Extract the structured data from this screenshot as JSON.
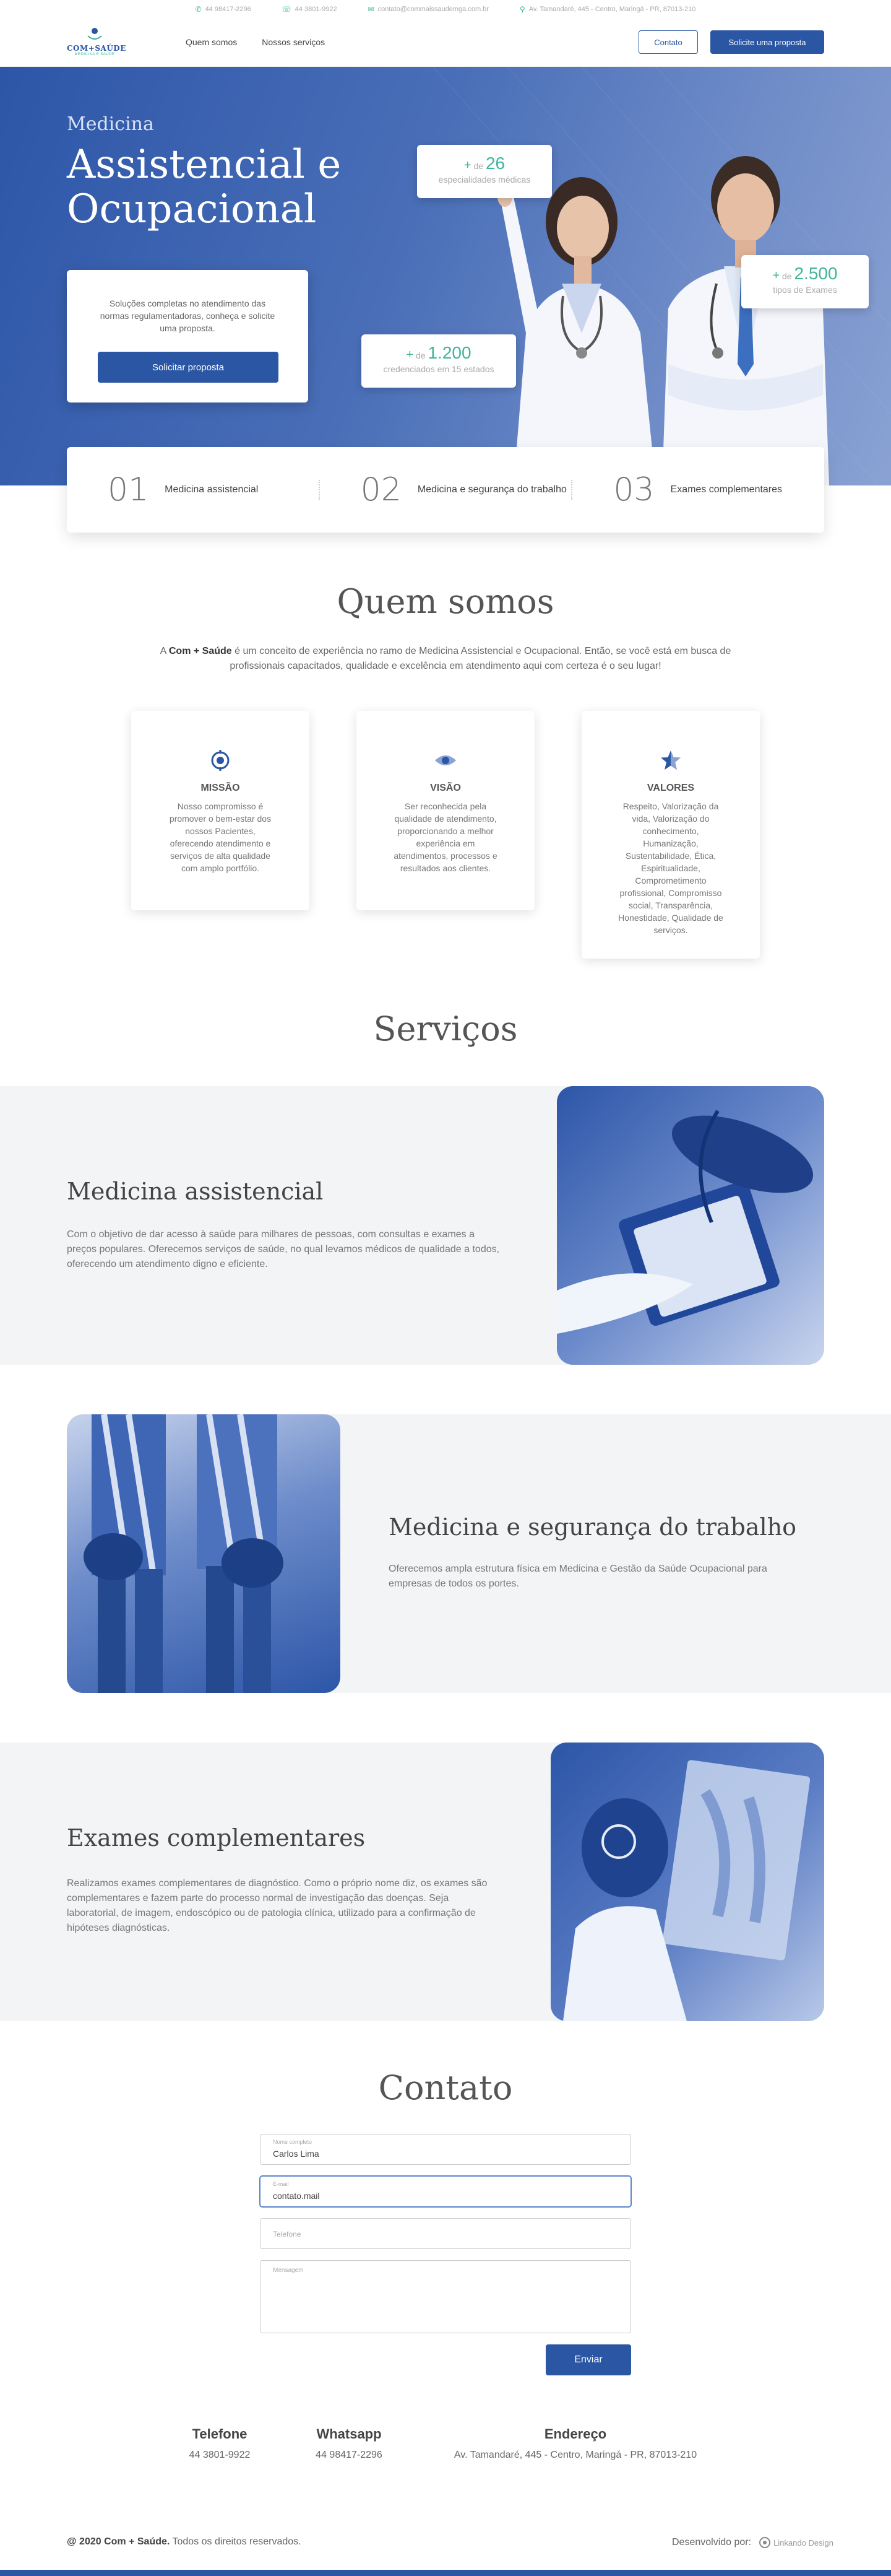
{
  "topbar": {
    "whatsapp": "44 98417-2296",
    "phone": "44 3801-9922",
    "email": "contato@commaissaudemga.com.br",
    "address": "Av. Tamandaré, 445 - Centro, Maringá - PR, 87013-210"
  },
  "header": {
    "logo_name": "COM+SAÚDE",
    "logo_tag": "MEDICINA E SAÚDE",
    "nav": [
      "Quem somos",
      "Nossos serviços"
    ],
    "contact_button": "Contato",
    "proposal_button": "Solicite uma proposta"
  },
  "hero": {
    "kicker": "Medicina",
    "title": "Assistencial e Ocupacional",
    "card_text": "Soluções completas no atendimento das normas regulamentadoras, conheça e solicite uma proposta.",
    "card_button": "Solicitar proposta",
    "stats": [
      {
        "prefix": "de",
        "number": "26",
        "label": "especialidades médicas"
      },
      {
        "prefix": "de",
        "number": "1.200",
        "label": "credenciados em 15 estados"
      },
      {
        "prefix": "de",
        "number": "2.500",
        "label": "tipos de Exames"
      }
    ]
  },
  "strip": [
    {
      "num": "01",
      "label": "Medicina assistencial"
    },
    {
      "num": "02",
      "label": "Medicina e segurança do trabalho"
    },
    {
      "num": "03",
      "label": "Exames complementares"
    }
  ],
  "about": {
    "title": "Quem somos",
    "intro_pre": "A ",
    "intro_brand": "Com + Saúde",
    "intro_post": " é um conceito de experiência no ramo de Medicina Assistencial e Ocupacional. Então, se você está em busca de profissionais capacitados, qualidade e excelência em atendimento aqui com certeza é o seu lugar!",
    "cards": [
      {
        "icon": "target-icon",
        "title": "MISSÃO",
        "text": "Nosso compromisso é promover o bem-estar dos nossos Pacientes, oferecendo atendimento e serviços de alta qualidade com amplo portfólio."
      },
      {
        "icon": "eye-icon",
        "title": "VISÃO",
        "text": "Ser reconhecida pela qualidade de atendimento, proporcionando a melhor experiência em atendimentos, processos e resultados aos clientes."
      },
      {
        "icon": "star-icon",
        "title": "VALORES",
        "text": "Respeito, Valorização da vida, Valorização do conhecimento, Humanização, Sustentabilidade, Ética, Espiritualidade, Comprometimento profissional, Compromisso social, Transparência, Honestidade, Qualidade de serviços."
      }
    ]
  },
  "services": {
    "title": "Serviços",
    "items": [
      {
        "title": "Medicina assistencial",
        "text": "Com o objetivo de dar acesso à saúde para milhares de pessoas, com consultas e exames a preços populares. Oferecemos serviços de saúde, no qual levamos médicos de qualidade a todos, oferecendo um atendimento digno e eficiente."
      },
      {
        "title": "Medicina e segurança do trabalho",
        "text": "Oferecemos ampla estrutura física em Medicina e Gestão da Saúde Ocupacional para empresas de todos os portes."
      },
      {
        "title": "Exames complementares",
        "text": "Realizamos exames complementares de diagnóstico. Como o próprio nome diz, os exames são complementares e fazem parte do processo normal de investigação das doenças. Seja laboratorial, de imagem, endoscópico ou de patologia clínica, utilizado para a confirmação de hipóteses diagnósticas."
      }
    ]
  },
  "contact": {
    "title": "Contato",
    "fields": [
      {
        "label": "Nome completo",
        "value": "Carlos Lima"
      },
      {
        "label": "E-mail",
        "value": "contato.mail"
      },
      {
        "placeholder": "Telefone"
      },
      {
        "placeholder": "Mensagem"
      }
    ],
    "send": "Enviar",
    "info": [
      {
        "key": "Telefone",
        "value": "44 3801-9922"
      },
      {
        "key": "Whatsapp",
        "value": "44 98417-2296"
      },
      {
        "key": "Endereço",
        "value": "Av. Tamandaré, 445 - Centro, Maringá - PR, 87013-210"
      }
    ]
  },
  "footer": {
    "copyright_brand": "@ 2020 Com + Saúde.",
    "copyright_rest": " Todos os direitos reservados.",
    "developed_by": "Desenvolvido por:",
    "dev_logo": "Linkando Design"
  },
  "colors": {
    "primary": "#2b56a4",
    "accent": "#3fb59a",
    "panel": "#f3f4f6"
  }
}
